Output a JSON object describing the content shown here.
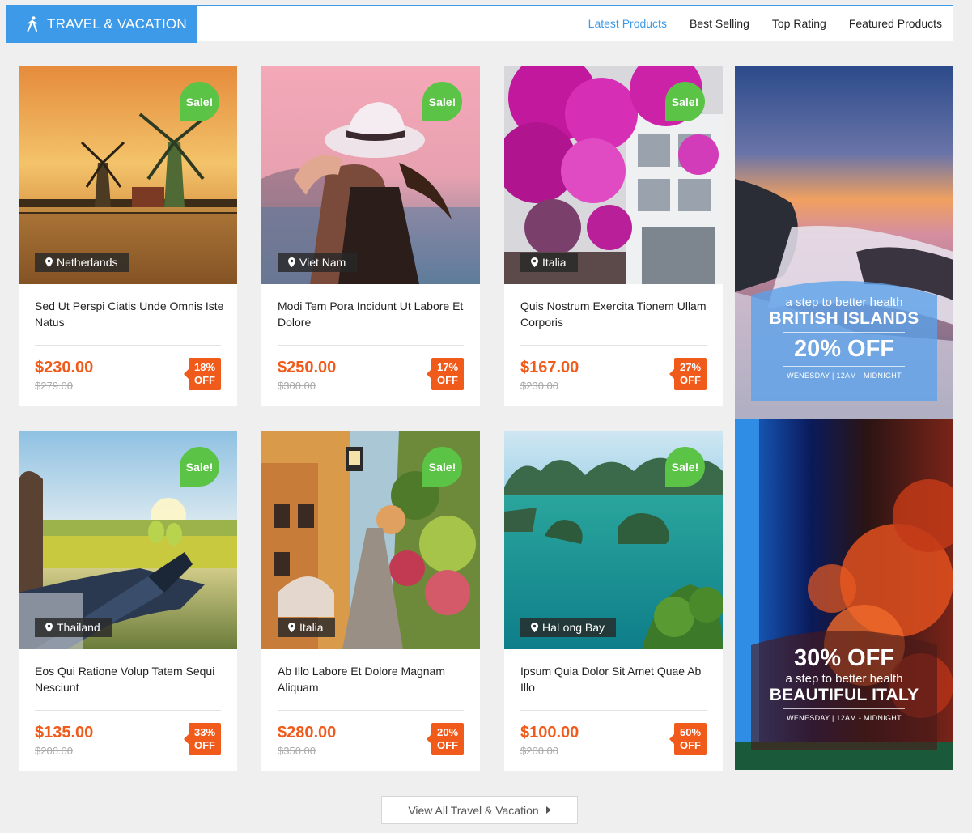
{
  "header": {
    "category_title": "TRAVEL & VACATION",
    "category_icon": "walking-person-icon",
    "tabs": [
      {
        "label": "Latest Products",
        "active": true
      },
      {
        "label": "Best Selling",
        "active": false
      },
      {
        "label": "Top Rating",
        "active": false
      },
      {
        "label": "Featured Products",
        "active": false
      }
    ]
  },
  "products": [
    {
      "title": "Sed Ut Perspi Ciatis Unde Omnis Iste Natus",
      "location": "Netherlands",
      "badge": "Sale!",
      "price": "$230.00",
      "old_price": "$279.00",
      "discount_pct": "18%",
      "discount_label": "OFF"
    },
    {
      "title": "Modi Tem Pora Incidunt Ut Labore Et Dolore",
      "location": "Viet Nam",
      "badge": "Sale!",
      "price": "$250.00",
      "old_price": "$300.00",
      "discount_pct": "17%",
      "discount_label": "OFF"
    },
    {
      "title": "Quis Nostrum Exercita Tionem Ullam Corporis",
      "location": "Italia",
      "badge": "Sale!",
      "price": "$167.00",
      "old_price": "$230.00",
      "discount_pct": "27%",
      "discount_label": "OFF"
    },
    {
      "title": "Eos Qui Ratione Volup Tatem Sequi Nesciunt",
      "location": "Thailand",
      "badge": "Sale!",
      "price": "$135.00",
      "old_price": "$200.00",
      "discount_pct": "33%",
      "discount_label": "OFF"
    },
    {
      "title": "Ab Illo Labore Et Dolore Magnam Aliquam",
      "location": "Italia",
      "badge": "Sale!",
      "price": "$280.00",
      "old_price": "$350.00",
      "discount_pct": "20%",
      "discount_label": "OFF"
    },
    {
      "title": "Ipsum Quia Dolor Sit Amet Quae Ab Illo",
      "location": "HaLong Bay",
      "badge": "Sale!",
      "price": "$100.00",
      "old_price": "$200.00",
      "discount_pct": "50%",
      "discount_label": "OFF"
    }
  ],
  "banners": [
    {
      "tagline": "a step to better health",
      "place": "BRITISH ISLANDS",
      "discount": "20% OFF",
      "schedule": "WENESDAY  |  12AM - MIDNIGHT"
    },
    {
      "tagline": "a step to better health",
      "place": "BEAUTIFUL ITALY",
      "discount": "30% OFF",
      "schedule": "WENESDAY  |  12AM - MIDNIGHT"
    }
  ],
  "view_all": {
    "label": "View All Travel & Vacation",
    "icon": "caret-right-icon"
  },
  "colors": {
    "accent": "#3d9ae8",
    "price": "#f05a1a",
    "sale": "#5bc346"
  }
}
